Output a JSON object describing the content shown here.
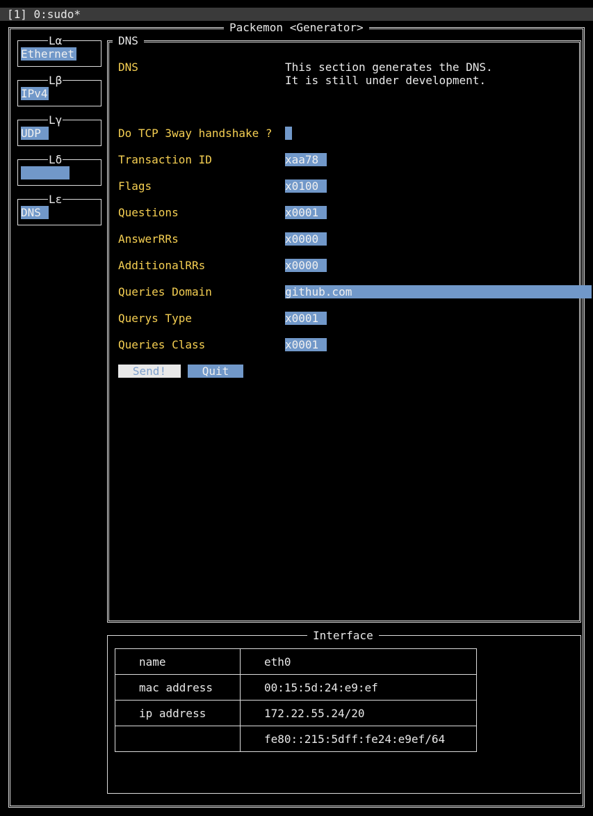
{
  "status_bar": {
    "text": "[1] 0:sudo*"
  },
  "app": {
    "title": "Packemon <Generator>"
  },
  "layers": [
    {
      "label": "Lα",
      "value": "Ethernet"
    },
    {
      "label": "Lβ",
      "value": "IPv4"
    },
    {
      "label": "Lγ",
      "value": "UDP"
    },
    {
      "label": "Lδ",
      "value": ""
    },
    {
      "label": "Lε",
      "value": "DNS"
    }
  ],
  "dns_panel": {
    "title": "DNS",
    "section_label": "DNS",
    "description_line1": "This section generates the DNS.",
    "description_line2": "It is still under development.",
    "tcp_handshake_label": "Do TCP 3way handshake ?",
    "tcp_handshake_value": "",
    "fields": [
      {
        "label": "Transaction ID",
        "value": "xaa78"
      },
      {
        "label": "Flags",
        "value": "x0100"
      },
      {
        "label": "Questions",
        "value": "x0001"
      },
      {
        "label": "AnswerRRs",
        "value": "x0000"
      },
      {
        "label": "AdditionalRRs",
        "value": "x0000"
      },
      {
        "label": "Queries Domain",
        "value": "github.com"
      },
      {
        "label": "Querys Type",
        "value": "x0001"
      },
      {
        "label": "Queries Class",
        "value": "x0001"
      }
    ],
    "send_label": "Send!",
    "quit_label": "Quit"
  },
  "interface_panel": {
    "title": "Interface",
    "rows": [
      {
        "key": "name",
        "value": "eth0"
      },
      {
        "key": "mac address",
        "value": "00:15:5d:24:e9:ef"
      },
      {
        "key": "ip address",
        "value": "172.22.55.24/20"
      },
      {
        "key": "",
        "value": "fe80::215:5dff:fe24:e9ef/64"
      }
    ]
  },
  "colors": {
    "background": "#000000",
    "label_yellow": "#f5cf52",
    "highlight_blue": "#7198c9",
    "status_bar": "#3a3a3a"
  }
}
